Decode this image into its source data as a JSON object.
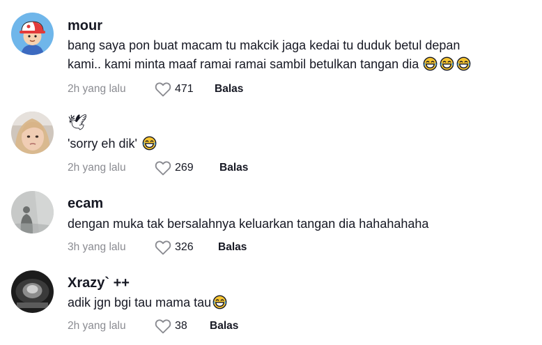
{
  "comments": [
    {
      "username": "mour",
      "text_line1": "bang saya pon buat macam tu makcik jaga kedai tu duduk betul depan",
      "text_line2": "kami.. kami minta maaf ramai ramai sambil betulkan tangan dia",
      "emoji_count": 3,
      "time": "2h yang lalu",
      "likes": "471",
      "reply": "Balas"
    },
    {
      "username": "🕊",
      "text_line1": "'sorry eh dik'",
      "emoji_count": 1,
      "time": "2h yang lalu",
      "likes": "269",
      "reply": "Balas"
    },
    {
      "username": "ecam",
      "text_line1": "dengan muka tak bersalahnya keluarkan tangan dia hahahahaha",
      "emoji_count": 0,
      "time": "3h yang lalu",
      "likes": "326",
      "reply": "Balas"
    },
    {
      "username": "Xrazy` ++",
      "text_line1": "adik jgn bgi tau mama tau",
      "emoji_count": 1,
      "time": "2h yang lalu",
      "likes": "38",
      "reply": "Balas"
    }
  ],
  "icons": {
    "like": "heart-outline-icon",
    "emoji": "laughing-tears-emoji"
  },
  "colors": {
    "text": "#161823",
    "meta": "#8a8b91",
    "emoji_face": "#f7c531"
  }
}
